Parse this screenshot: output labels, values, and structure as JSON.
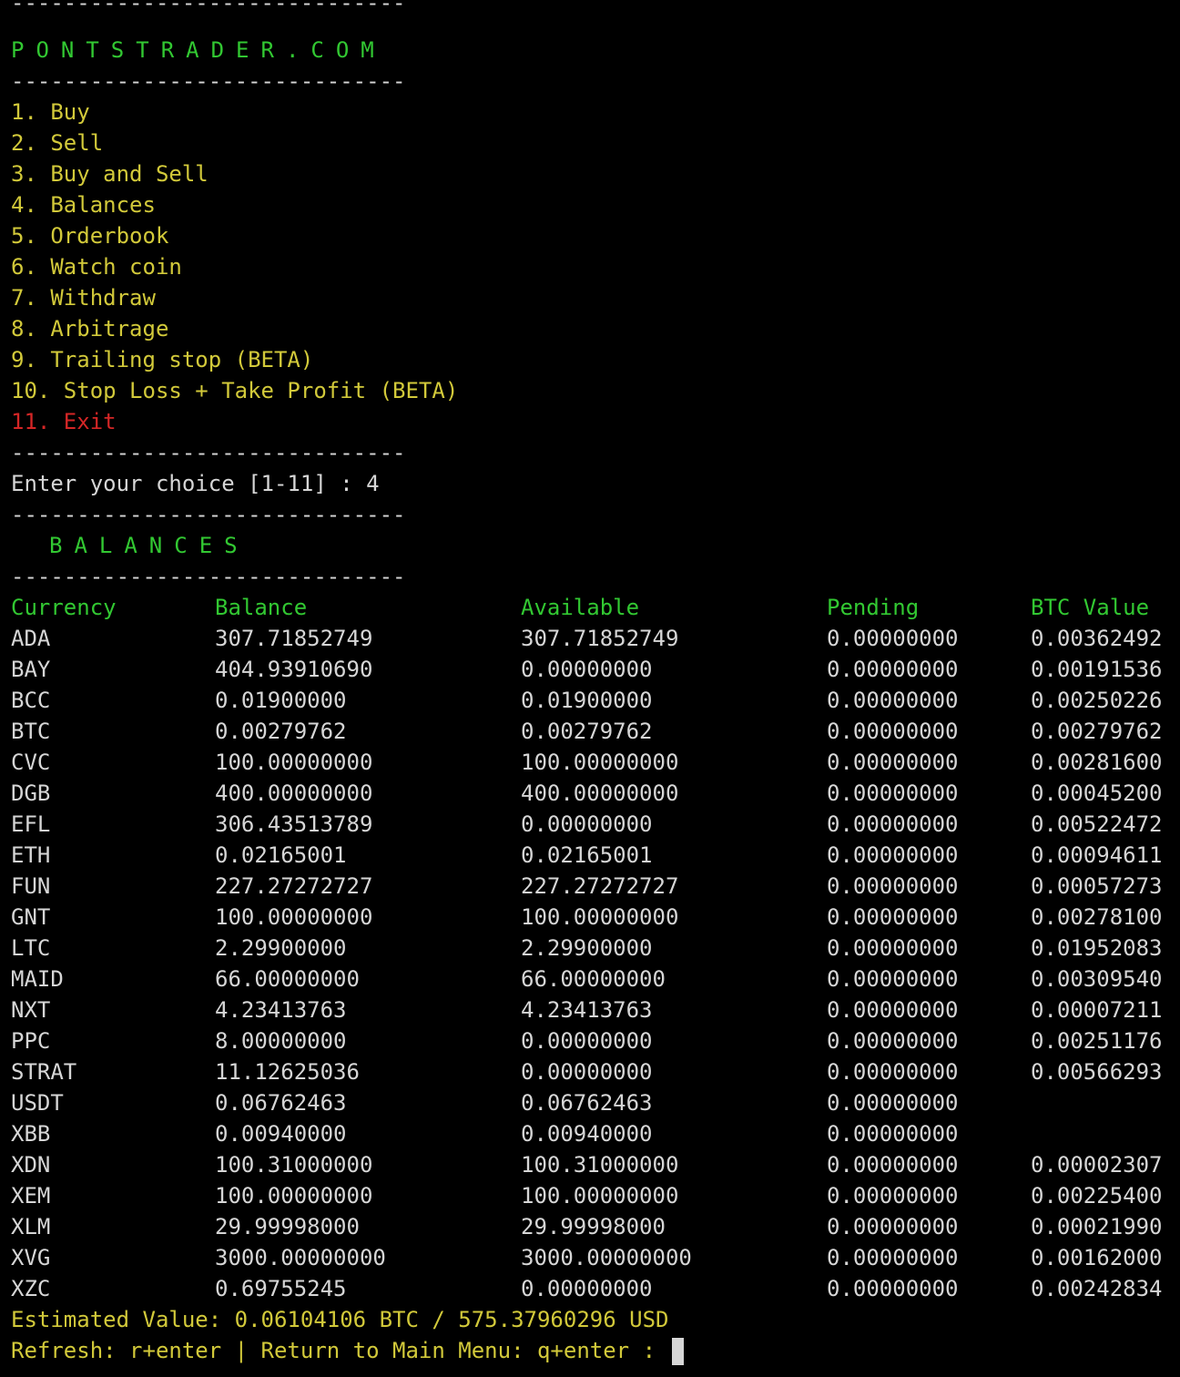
{
  "divider": "------------------------------",
  "brand": "PONTSTRADER.COM",
  "menu": [
    {
      "label": "1. Buy"
    },
    {
      "label": "2. Sell"
    },
    {
      "label": "3. Buy and Sell"
    },
    {
      "label": "4. Balances"
    },
    {
      "label": "5. Orderbook"
    },
    {
      "label": "6. Watch coin"
    },
    {
      "label": "7. Withdraw"
    },
    {
      "label": "8. Arbitrage"
    },
    {
      "label": "9. Trailing stop (BETA)"
    },
    {
      "label": "10. Stop Loss + Take Profit (BETA)"
    },
    {
      "label": "11. Exit"
    }
  ],
  "prompt": {
    "text": "Enter your choice [1-11] : 4"
  },
  "balances_title": "BALANCES",
  "table": {
    "headers": [
      "Currency",
      "Balance",
      "Available",
      "Pending",
      "BTC Value"
    ],
    "rows": [
      [
        "ADA",
        "307.71852749",
        "307.71852749",
        "0.00000000",
        "0.00362492"
      ],
      [
        "BAY",
        "404.93910690",
        "0.00000000",
        "0.00000000",
        "0.00191536"
      ],
      [
        "BCC",
        "0.01900000",
        "0.01900000",
        "0.00000000",
        "0.00250226"
      ],
      [
        "BTC",
        "0.00279762",
        "0.00279762",
        "0.00000000",
        "0.00279762"
      ],
      [
        "CVC",
        "100.00000000",
        "100.00000000",
        "0.00000000",
        "0.00281600"
      ],
      [
        "DGB",
        "400.00000000",
        "400.00000000",
        "0.00000000",
        "0.00045200"
      ],
      [
        "EFL",
        "306.43513789",
        "0.00000000",
        "0.00000000",
        "0.00522472"
      ],
      [
        "ETH",
        "0.02165001",
        "0.02165001",
        "0.00000000",
        "0.00094611"
      ],
      [
        "FUN",
        "227.27272727",
        "227.27272727",
        "0.00000000",
        "0.00057273"
      ],
      [
        "GNT",
        "100.00000000",
        "100.00000000",
        "0.00000000",
        "0.00278100"
      ],
      [
        "LTC",
        "2.29900000",
        "2.29900000",
        "0.00000000",
        "0.01952083"
      ],
      [
        "MAID",
        "66.00000000",
        "66.00000000",
        "0.00000000",
        "0.00309540"
      ],
      [
        "NXT",
        "4.23413763",
        "4.23413763",
        "0.00000000",
        "0.00007211"
      ],
      [
        "PPC",
        "8.00000000",
        "0.00000000",
        "0.00000000",
        "0.00251176"
      ],
      [
        "STRAT",
        "11.12625036",
        "0.00000000",
        "0.00000000",
        "0.00566293"
      ],
      [
        "USDT",
        "0.06762463",
        "0.06762463",
        "0.00000000",
        ""
      ],
      [
        "XBB",
        "0.00940000",
        "0.00940000",
        "0.00000000",
        ""
      ],
      [
        "XDN",
        "100.31000000",
        "100.31000000",
        "0.00000000",
        "0.00002307"
      ],
      [
        "XEM",
        "100.00000000",
        "100.00000000",
        "0.00000000",
        "0.00225400"
      ],
      [
        "XLM",
        "29.99998000",
        "29.99998000",
        "0.00000000",
        "0.00021990"
      ],
      [
        "XVG",
        "3000.00000000",
        "3000.00000000",
        "0.00000000",
        "0.00162000"
      ],
      [
        "XZC",
        "0.69755245",
        "0.00000000",
        "0.00000000",
        "0.00242834"
      ]
    ]
  },
  "estimated": "Estimated Value: 0.06104106 BTC / 575.37960296 USD",
  "footer": "Refresh: r+enter | Return to Main Menu: q+enter : ",
  "colors": {
    "background": "#000000",
    "green": "#32c832",
    "yellow": "#d2c93a",
    "red": "#d42626",
    "text": "#d6d6d6"
  }
}
